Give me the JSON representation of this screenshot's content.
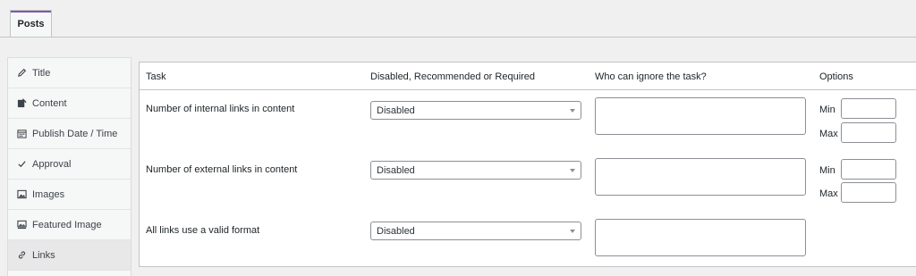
{
  "tabs": [
    {
      "label": "Posts"
    }
  ],
  "sidebar": {
    "items": [
      {
        "label": "Title",
        "icon": "pencil-icon"
      },
      {
        "label": "Content",
        "icon": "content-icon"
      },
      {
        "label": "Publish Date / Time",
        "icon": "calendar-icon"
      },
      {
        "label": "Approval",
        "icon": "checkmark-icon"
      },
      {
        "label": "Images",
        "icon": "image-icon"
      },
      {
        "label": "Featured Image",
        "icon": "featured-image-icon"
      },
      {
        "label": "Links",
        "icon": "link-icon",
        "active": true
      }
    ]
  },
  "table": {
    "headers": {
      "task": "Task",
      "requirement": "Disabled, Recommended or Required",
      "ignore": "Who can ignore the task?",
      "options": "Options"
    },
    "rows": [
      {
        "task": "Number of internal links in content",
        "requirement": "Disabled",
        "ignore_value": "",
        "min_label": "Min",
        "min_value": "",
        "max_label": "Max",
        "max_value": ""
      },
      {
        "task": "Number of external links in content",
        "requirement": "Disabled",
        "ignore_value": "",
        "min_label": "Min",
        "min_value": "",
        "max_label": "Max",
        "max_value": ""
      },
      {
        "task": "All links use a valid format",
        "requirement": "Disabled",
        "ignore_value": ""
      }
    ]
  },
  "colors": {
    "accent": "#7f54b3",
    "border": "#c3c4c7",
    "background": "#f0f0f1"
  }
}
